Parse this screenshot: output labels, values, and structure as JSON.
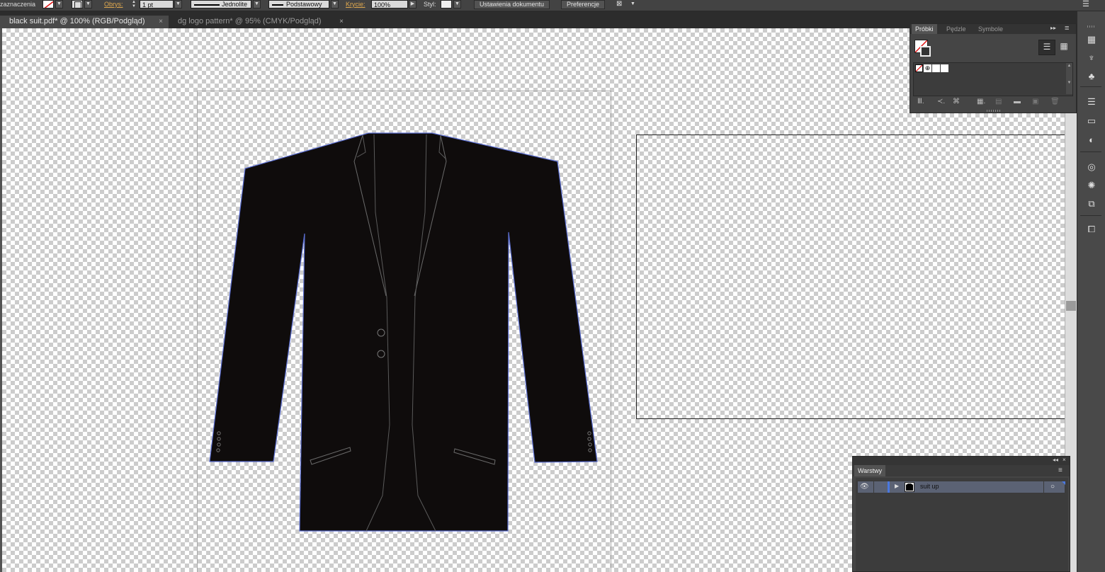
{
  "control_bar": {
    "selection_label": "zaznaczenia",
    "stroke_label": "Obrys:",
    "stroke_weight": "1 pt",
    "stroke_profile": "Jednolite",
    "brush_definition": "Podstawowy",
    "opacity_label": "Krycie:",
    "opacity_value": "100%",
    "style_label": "Styl:",
    "document_setup_button": "Ustawienia dokumentu",
    "preferences_button": "Preferencje"
  },
  "tabs": [
    {
      "label": "black suit.pdf* @ 100% (RGB/Podgląd)",
      "close": "×"
    },
    {
      "label": "dg logo pattern* @ 95% (CMYK/Podgląd)",
      "close": "×"
    }
  ],
  "swatches_panel": {
    "tabs": [
      "Próbki",
      "Pędzle",
      "Symbole"
    ],
    "collapse_glyph": "▸▸",
    "menu_glyph": "≡"
  },
  "layers_panel": {
    "title": "Warstwy",
    "layers": [
      {
        "name": "suit up",
        "visible": true
      }
    ]
  },
  "colors": {
    "accent_orange": "#e0a94f",
    "suit_fill": "#0f0c0c",
    "selection_outline": "#5b6ed0",
    "layer_color": "#4a78e0"
  },
  "icons": {
    "right_dock": [
      "libraries-icon",
      "puppet-icon",
      "symbols-icon",
      "stroke-icon",
      "gradient-icon",
      "transparency-icon",
      "appearance-icon",
      "graphic-styles-icon",
      "transform-icon",
      "pathfinder-icon"
    ]
  }
}
